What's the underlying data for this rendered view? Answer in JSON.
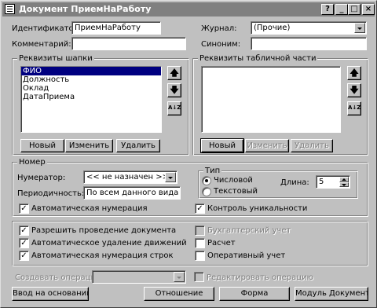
{
  "window": {
    "title": "Документ ПриемНаРаботу",
    "help_glyph": "?",
    "minimize_glyph": "_",
    "maximize_glyph": "□",
    "close_glyph": "×"
  },
  "identifier": {
    "label": "Идентификатор:",
    "value": "ПриемНаРаботу"
  },
  "journal": {
    "label": "Журнал:",
    "value": "(Прочие)"
  },
  "comment": {
    "label": "Комментарий:",
    "value": ""
  },
  "synonym": {
    "label": "Синоним:",
    "value": ""
  },
  "header_attrs": {
    "title": "Реквизиты шапки",
    "items": [
      "ФИО",
      "Должность",
      "Оклад",
      "ДатаПриема"
    ],
    "selected_index": 0,
    "buttons": {
      "new": "Новый",
      "edit": "Изменить",
      "delete": "Удалить"
    }
  },
  "table_attrs": {
    "title": "Реквизиты табличной части",
    "items": [],
    "buttons": {
      "new": "Новый",
      "edit": "Изменить",
      "delete": "Удалить"
    }
  },
  "arrows": {
    "up": "🡅",
    "down": "🡇",
    "sort": "A↓Z"
  },
  "number": {
    "title": "Номер",
    "numerator_label": "Нумератор:",
    "numerator_value": "<< не назначен >>",
    "periodicity_label": "Периодичность:",
    "periodicity_value": "По всем данного вида",
    "auto_numbering": {
      "label": "Автоматическая нумерация",
      "checked": true
    },
    "uniqueness": {
      "label": "Контроль уникальности",
      "checked": true
    }
  },
  "type": {
    "title": "Тип",
    "numeric": {
      "label": "Числовой",
      "selected": true
    },
    "text": {
      "label": "Текстовый",
      "selected": false
    },
    "length_label": "Длина:",
    "length_value": "5"
  },
  "options": {
    "allow_posting": {
      "label": "Разрешить проведение документа",
      "checked": true
    },
    "auto_delete_movements": {
      "label": "Автоматическое удаление движений",
      "checked": true
    },
    "auto_row_numbering": {
      "label": "Автоматическая нумерация строк",
      "checked": true
    },
    "accounting": {
      "label": "Бухгалтерский учет",
      "checked": false,
      "disabled": true
    },
    "calculation": {
      "label": "Расчет",
      "checked": false
    },
    "operational": {
      "label": "Оперативный учет",
      "checked": false
    }
  },
  "create_operation": {
    "label": "Создавать операции:",
    "value": "",
    "edit_operation": {
      "label": "Редактировать операцию",
      "checked": false
    }
  },
  "footer": {
    "based_on": "Ввод на основании...",
    "journals": "Отношение",
    "form": "Форма",
    "module": "Модуль Документа"
  },
  "colors": {
    "face": "#c0c0c0",
    "title_bar": "#808080",
    "selection": "#000080"
  }
}
